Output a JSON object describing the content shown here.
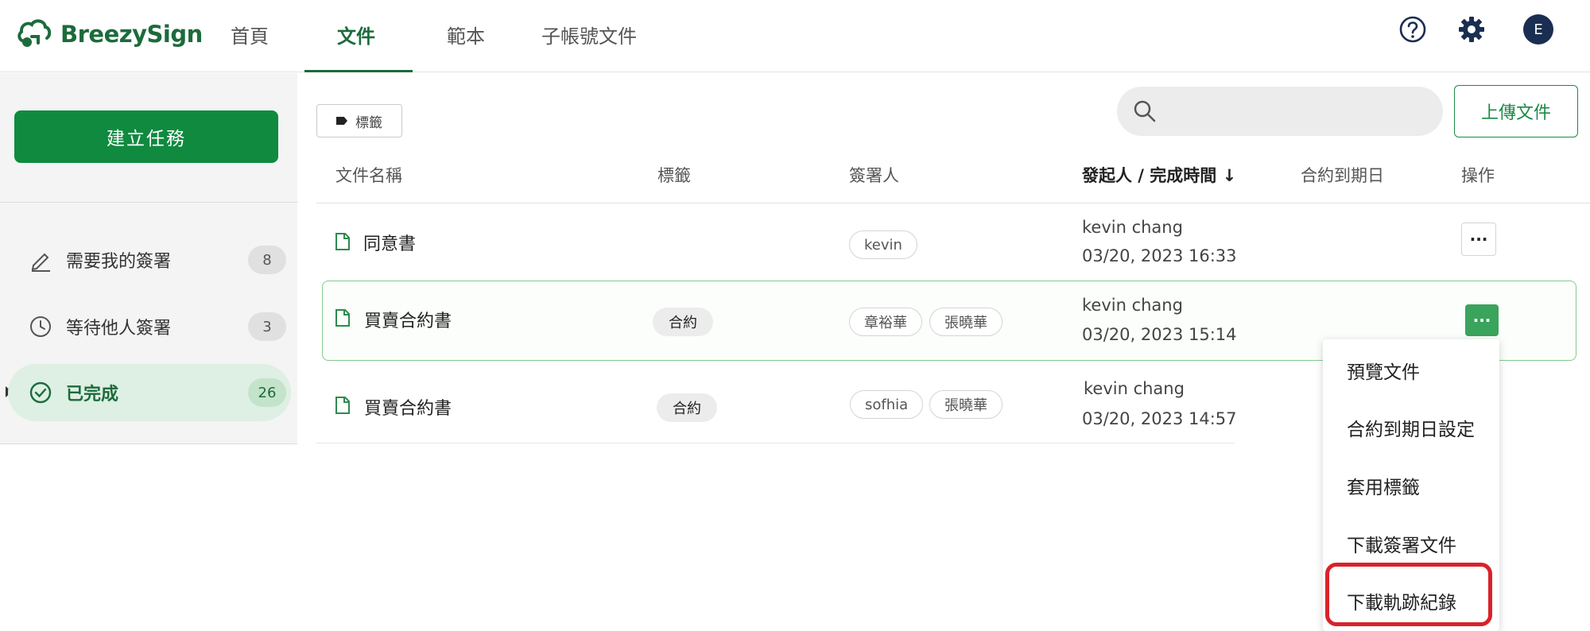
{
  "app": {
    "name": "BreezySign"
  },
  "nav": {
    "tabs": [
      "首頁",
      "文件",
      "範本",
      "子帳號文件"
    ],
    "active": "文件"
  },
  "user": {
    "avatar_initial": "E"
  },
  "sidebar": {
    "create_button": "建立任務",
    "items": [
      {
        "label": "需要我的簽署",
        "count": "8"
      },
      {
        "label": "等待他人簽署",
        "count": "3"
      },
      {
        "label": "已完成",
        "count": "26"
      }
    ],
    "active_item": "已完成"
  },
  "toolbar": {
    "tag_filter": "標籤",
    "search_placeholder": "",
    "upload_button": "上傳文件"
  },
  "table": {
    "headers": {
      "name": "文件名稱",
      "tags": "標籤",
      "signers": "簽署人",
      "sender_time": "發起人 / 完成時間",
      "sort_arrow": "↓",
      "due": "合約到期日",
      "actions": "操作"
    },
    "rows": [
      {
        "name": "同意書",
        "tag": "",
        "signers": [
          "kevin"
        ],
        "sender": "kevin chang",
        "time": "03/20, 2023 16:33",
        "op": "···"
      },
      {
        "name": "買賣合約書",
        "tag": "合約",
        "signers": [
          "章裕華",
          "張曉華"
        ],
        "sender": "kevin chang",
        "time": "03/20, 2023 15:14",
        "op": "···"
      },
      {
        "name": "買賣合約書",
        "tag": "合約",
        "signers": [
          "sofhia",
          "張曉華"
        ],
        "sender": "kevin chang",
        "time": "03/20, 2023 14:57"
      }
    ]
  },
  "context_menu": {
    "items": [
      "預覽文件",
      "合約到期日設定",
      "套用標籤",
      "下載簽署文件",
      "下載軌跡紀錄"
    ],
    "highlighted": "下載軌跡紀錄"
  },
  "colors": {
    "brand": "#1c6b3c",
    "primary_button": "#0f8a3f",
    "highlight_border": "#d9222a",
    "row_highlight": "#86c98f"
  }
}
